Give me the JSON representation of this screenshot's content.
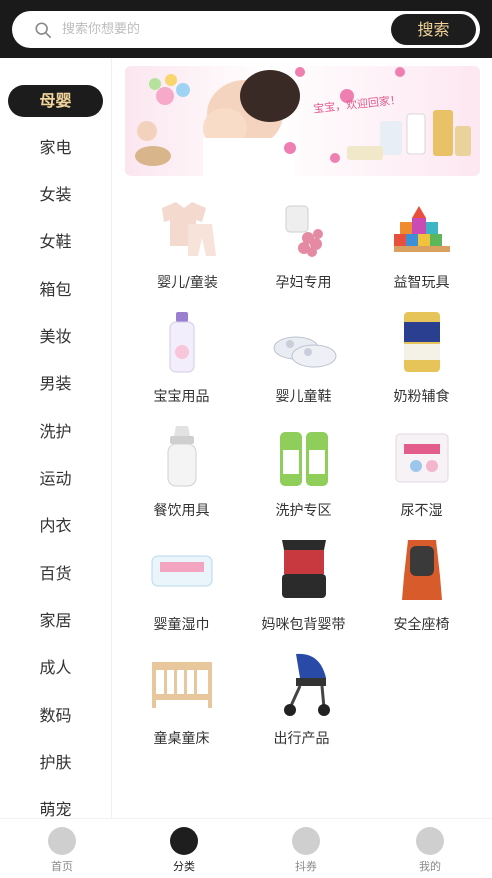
{
  "search": {
    "placeholder": "搜索你想要的",
    "button": "搜索"
  },
  "categories": [
    "母婴",
    "家电",
    "女装",
    "女鞋",
    "箱包",
    "美妆",
    "男装",
    "洗护",
    "运动",
    "内衣",
    "百货",
    "家居",
    "成人",
    "数码",
    "护肤",
    "萌宠"
  ],
  "banner": {
    "text": "宝宝，欢迎回家！"
  },
  "products": [
    {
      "label": "婴儿/童装",
      "icon": "baby-clothes-icon"
    },
    {
      "label": "孕妇专用",
      "icon": "pregnancy-items-icon"
    },
    {
      "label": "益智玩具",
      "icon": "building-blocks-icon"
    },
    {
      "label": "宝宝用品",
      "icon": "baby-lotion-icon"
    },
    {
      "label": "婴儿童鞋",
      "icon": "baby-shoes-icon"
    },
    {
      "label": "奶粉辅食",
      "icon": "milk-powder-icon"
    },
    {
      "label": "餐饮用具",
      "icon": "feeding-bottle-icon"
    },
    {
      "label": "洗护专区",
      "icon": "detergent-icon"
    },
    {
      "label": "尿不湿",
      "icon": "diapers-icon"
    },
    {
      "label": "婴童湿巾",
      "icon": "wet-wipes-icon"
    },
    {
      "label": "妈咪包背婴带",
      "icon": "baby-carrier-icon"
    },
    {
      "label": "安全座椅",
      "icon": "car-seat-icon"
    },
    {
      "label": "童桌童床",
      "icon": "crib-icon"
    },
    {
      "label": "出行产品",
      "icon": "stroller-icon"
    }
  ],
  "tabs": [
    {
      "label": "首页",
      "icon": "home-icon"
    },
    {
      "label": "分类",
      "icon": "category-icon"
    },
    {
      "label": "抖券",
      "icon": "coupon-icon"
    },
    {
      "label": "我的",
      "icon": "profile-icon"
    }
  ],
  "colors": {
    "accent": "#f1d49a",
    "dark": "#1c1c1c"
  }
}
